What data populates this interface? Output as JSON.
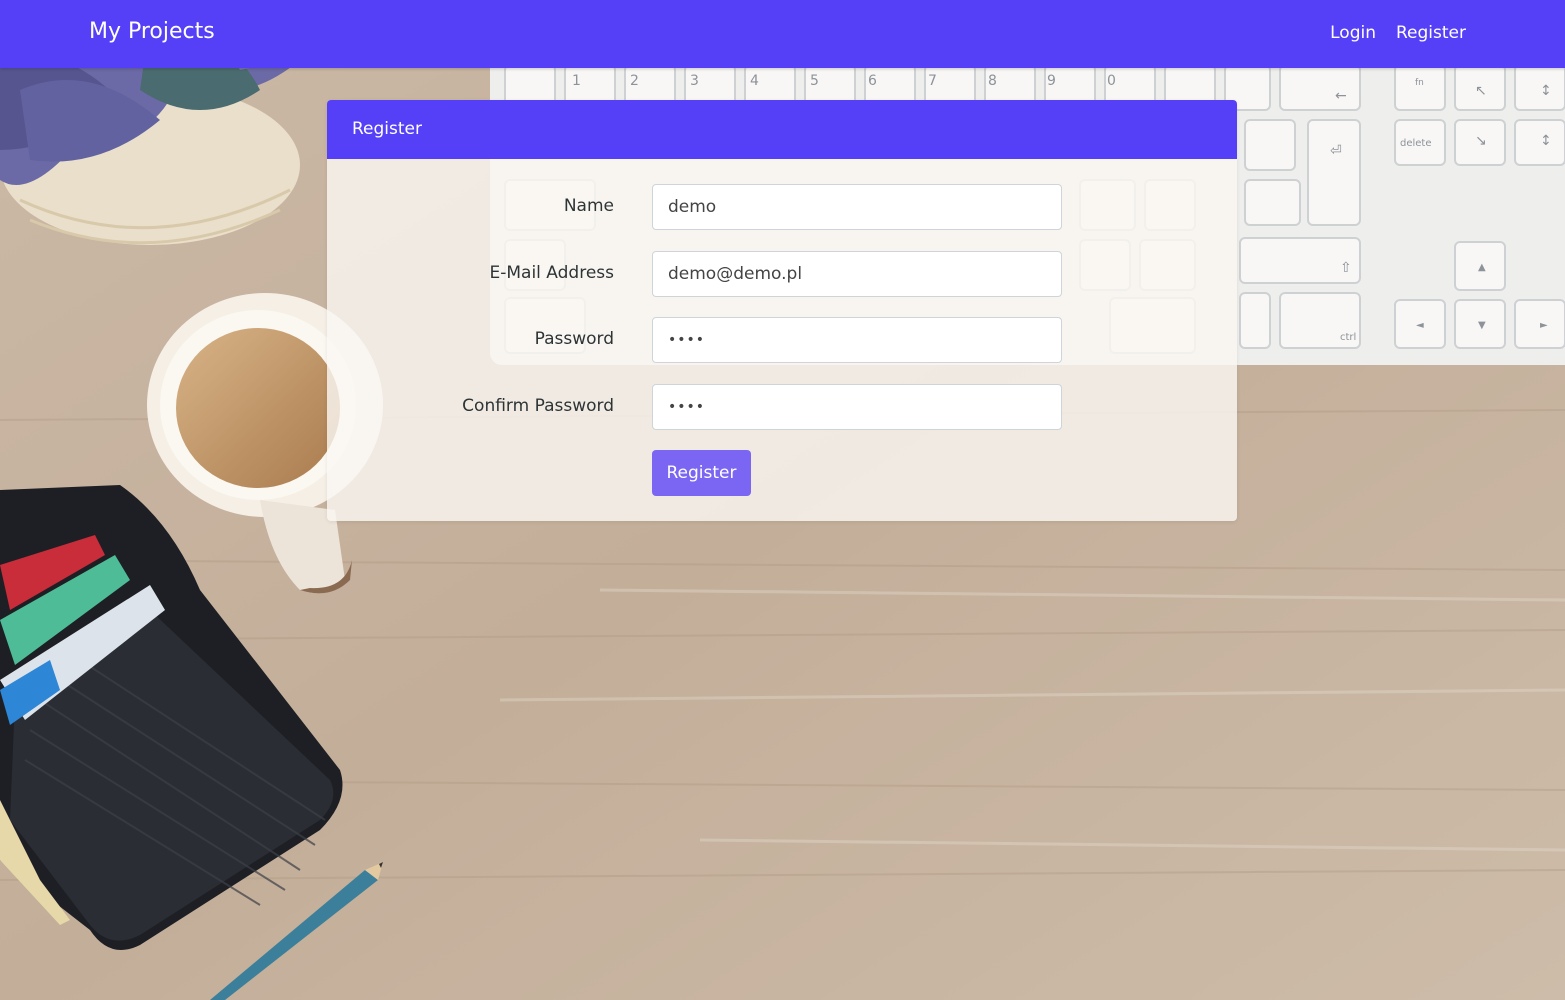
{
  "navbar": {
    "brand": "My Projects",
    "links": [
      "Login",
      "Register"
    ]
  },
  "card": {
    "title": "Register",
    "fields": [
      {
        "label": "Name",
        "value": "demo",
        "type": "text"
      },
      {
        "label": "E-Mail Address",
        "value": "demo@demo.pl",
        "type": "email"
      },
      {
        "label": "Password",
        "value": "demo",
        "type": "password"
      },
      {
        "label": "Confirm Password",
        "value": "demo",
        "type": "password"
      }
    ],
    "submit_label": "Register"
  },
  "colors": {
    "accent": "#5540f7",
    "button": "#7a66f2"
  }
}
